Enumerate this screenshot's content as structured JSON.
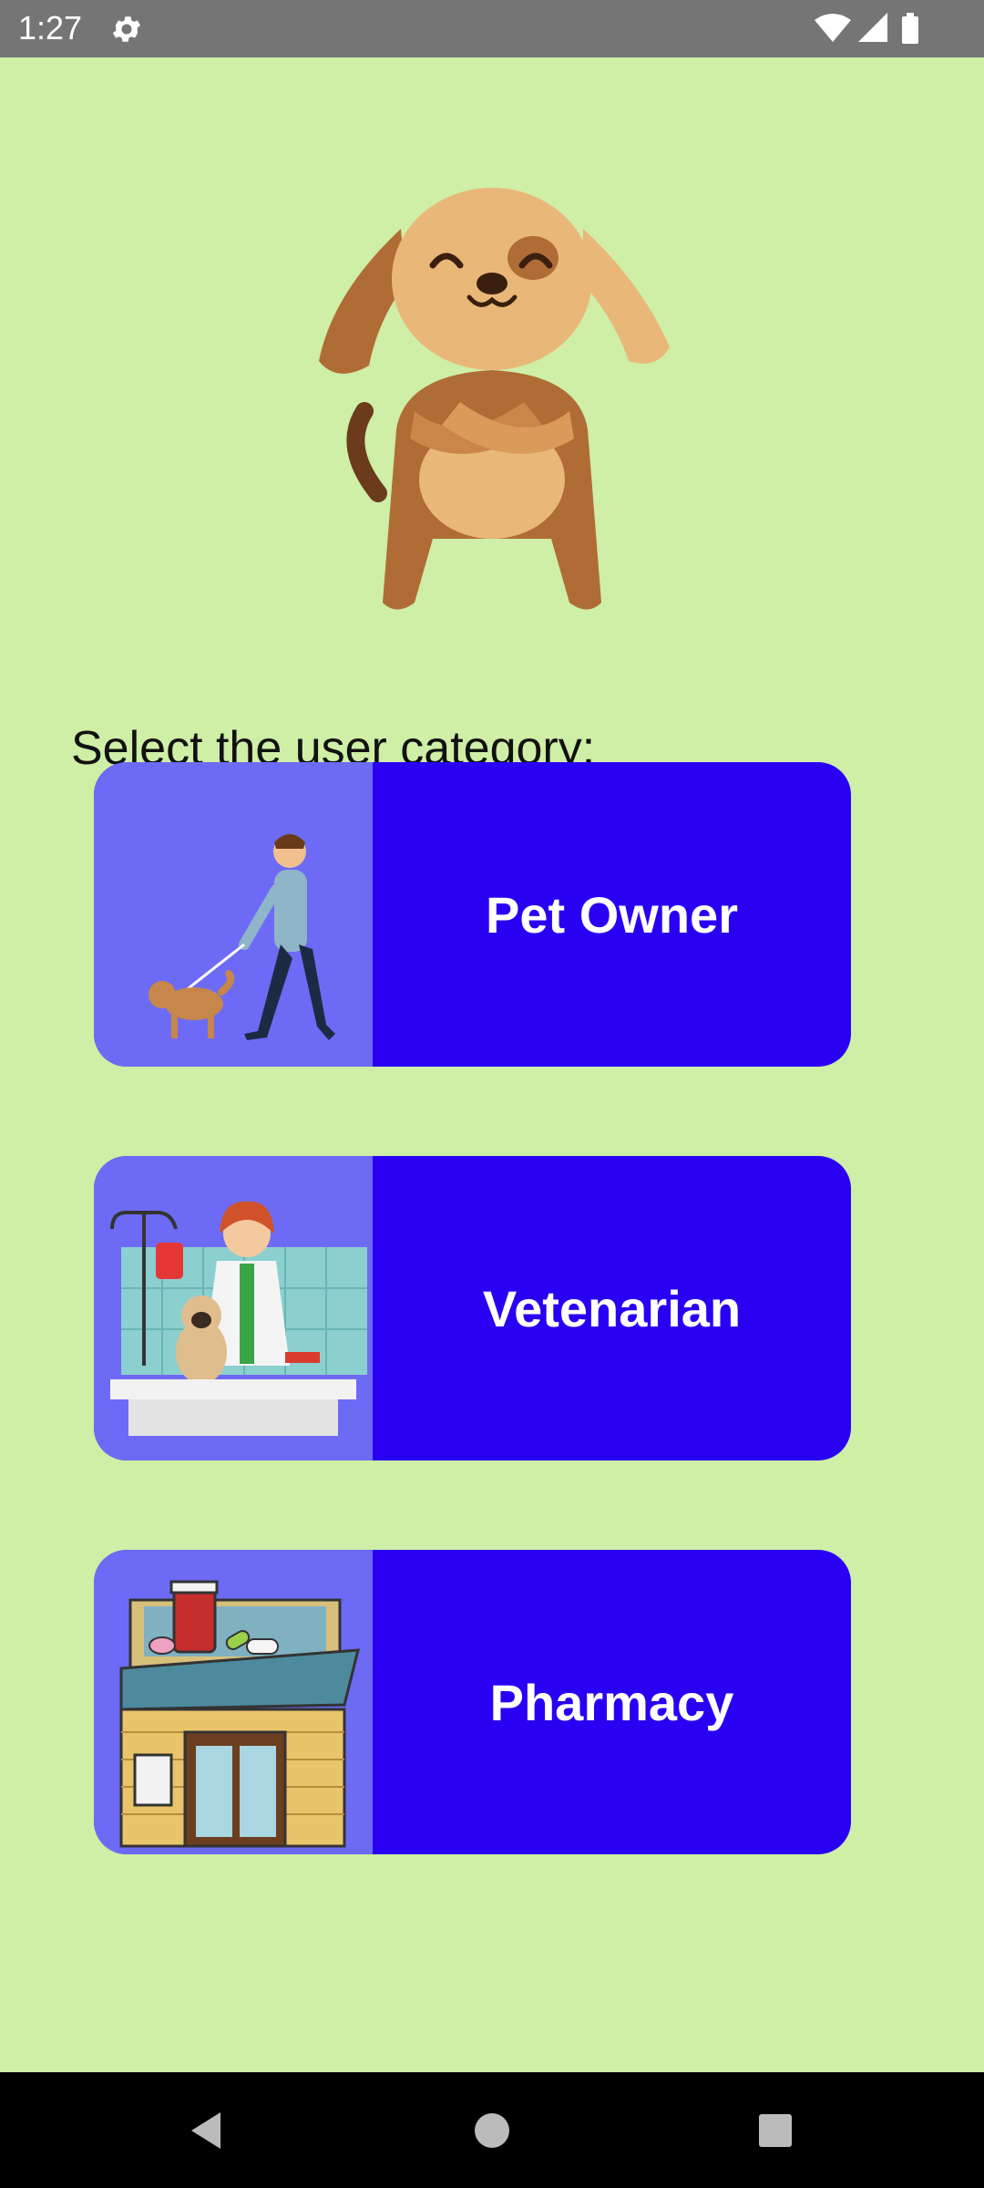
{
  "status_bar": {
    "time": "1:27",
    "icons": [
      "gear-icon",
      "wifi-icon",
      "signal-icon",
      "battery-icon"
    ]
  },
  "main": {
    "prompt": "Select the user category:",
    "categories": [
      {
        "label": "Pet Owner",
        "icon": "person-walking-dog-illustration"
      },
      {
        "label": "Vetenarian",
        "icon": "veterinarian-with-pug-illustration"
      },
      {
        "label": "Pharmacy",
        "icon": "pharmacy-building-illustration"
      }
    ]
  },
  "colors": {
    "background": "#cfeea6",
    "card_primary": "#2a00f3",
    "card_thumb": "#6d6bf5"
  },
  "nav_bar": {
    "buttons": [
      "back-icon",
      "home-icon",
      "recents-icon"
    ]
  }
}
